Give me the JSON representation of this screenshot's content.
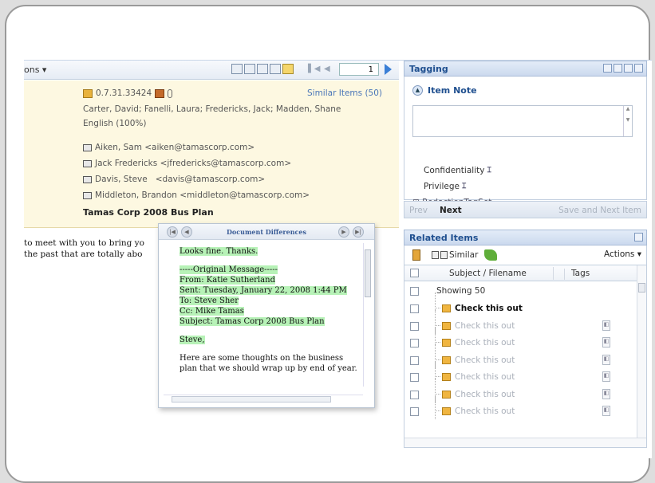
{
  "left": {
    "toolbar": {
      "actions_label": "ons ▾",
      "page_number": "1"
    },
    "header": {
      "doc_id": "0.7.31.33424",
      "similar_items": "Similar Items (50)",
      "participants": "Carter, David; Fanelli, Laura; Fredericks, Jack; Madden, Shane",
      "language": "English (100%)",
      "recipients": [
        "Aiken, Sam <aiken@tamascorp.com>",
        "Jack Fredericks <jfredericks@tamascorp.com>",
        "Davis, Steve   <davis@tamascorp.com>",
        "Middleton, Brandon <middleton@tamascorp.com>"
      ],
      "subject": "Tamas Corp 2008 Bus Plan"
    },
    "body_lines": [
      "to meet with you to bring yo",
      "the past that are totally abo"
    ]
  },
  "popup": {
    "title": "Document Differences",
    "lines_highlight_1": [
      "Looks fine. Thanks."
    ],
    "lines_highlight_2": [
      "-----Original Message-----",
      "From: Katie Sutherland",
      "Sent: Tuesday, January 22, 2008 1:44 PM",
      "To: Steve Sher",
      "Cc: Mike Tamas",
      "Subject: Tamas Corp 2008 Bus Plan"
    ],
    "greeting": "Steve,",
    "para": [
      "Here are some thoughts on the business",
      "plan that we should wrap up by end of year."
    ]
  },
  "tagging": {
    "title": "Tagging",
    "item_note": "Item Note",
    "confidentiality": "Confidentiality",
    "privilege": "Privilege",
    "redaction": "RedactionTagSet",
    "prev": "Prev",
    "next": "Next",
    "save_next": "Save and Next Item"
  },
  "related": {
    "title": "Related Items",
    "similar_label": "Similar",
    "actions_label": "Actions ▾",
    "col_subject": "Subject / Filename",
    "col_tags": "Tags",
    "showing": "Showing 50",
    "rows": [
      {
        "text": "Check this out",
        "bold": true
      },
      {
        "text": "Check this out",
        "bold": false
      },
      {
        "text": "Check this out",
        "bold": false
      },
      {
        "text": "Check this out",
        "bold": false
      },
      {
        "text": "Check this out",
        "bold": false
      },
      {
        "text": "Check this out",
        "bold": false
      },
      {
        "text": "Check this out",
        "bold": false
      }
    ]
  }
}
